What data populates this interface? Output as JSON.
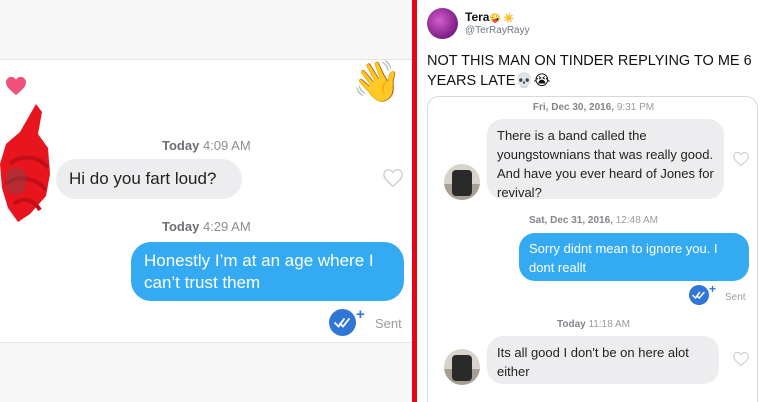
{
  "left": {
    "messages": [
      {
        "timestamp_day": "Today",
        "timestamp_time": "4:09 AM",
        "text": "Hi do you fart loud?"
      },
      {
        "timestamp_day": "Today",
        "timestamp_time": "4:29 AM",
        "text": "Honestly I’m at an age where I can’t trust them"
      }
    ],
    "status": "Sent",
    "wave_emoji": "👋",
    "icons": [
      "heart-icon",
      "wave-emoji-icon",
      "heart-outline-icon",
      "read-check-icon",
      "plus-icon"
    ]
  },
  "right": {
    "tweet": {
      "display_name": "Tera",
      "name_emojis": "🤪 ☀️",
      "handle": "@TerRayRayy",
      "text": "NOT THIS MAN ON TINDER REPLYING TO ME 6 YEARS LATE💀😭"
    },
    "screenshot": {
      "ts1_day": "Fri, Dec 30, 2016,",
      "ts1_time": "9:31 PM",
      "msg1": "There is a band called the youngstownians that was really good. And have you ever heard of Jones for revival?",
      "ts2_day": "Sat, Dec 31, 2016,",
      "ts2_time": "12:48 AM",
      "msg2": "Sorry didnt mean to ignore you. I dont reallt",
      "status": "Sent",
      "ts3_day": "Today",
      "ts3_time": "11:18 AM",
      "msg3": "Its all good I don't be on here alot either"
    }
  },
  "colors": {
    "accent_blue": "#34aaf2",
    "check_blue": "#2f76d6",
    "divider_red": "#e30613",
    "incoming_bubble": "#ededef"
  }
}
